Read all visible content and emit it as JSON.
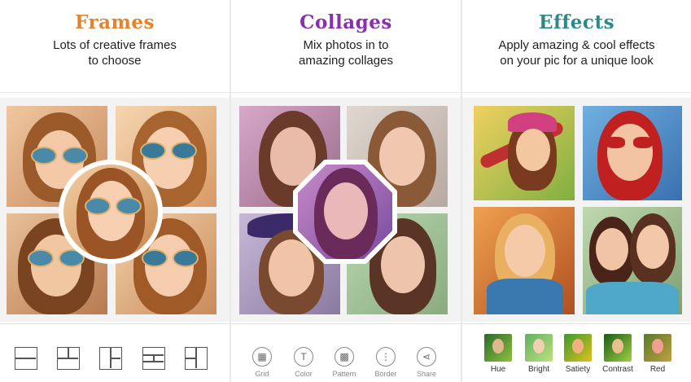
{
  "panels": [
    {
      "title": "Frames",
      "color": "#e8822a",
      "subtitle": [
        "Lots of creative frames",
        "to choose"
      ]
    },
    {
      "title": "Collages",
      "color": "#8a2fb0",
      "subtitle": [
        "Mix photos in to",
        "amazing collages"
      ]
    },
    {
      "title": "Effects",
      "color": "#2a8a8a",
      "subtitle": [
        "Apply amazing & cool effects",
        "on your pic for a unique look"
      ]
    }
  ],
  "frames_toolbar": {
    "icons": [
      "layout-two-rows-icon",
      "layout-grid-a-icon",
      "layout-grid-b-icon",
      "layout-three-rows-icon",
      "layout-grid-c-icon"
    ]
  },
  "collage_toolbar": [
    {
      "label": "Grid",
      "icon": "grid-icon",
      "glyph": "▦"
    },
    {
      "label": "Color",
      "icon": "color-icon",
      "glyph": "T"
    },
    {
      "label": "Pattern",
      "icon": "pattern-icon",
      "glyph": "▩"
    },
    {
      "label": "Border",
      "icon": "border-icon",
      "glyph": "⋮"
    },
    {
      "label": "Share",
      "icon": "share-icon",
      "glyph": "⋖"
    }
  ],
  "effects_toolbar": [
    {
      "label": "Hue"
    },
    {
      "label": "Bright"
    },
    {
      "label": "Satiety"
    },
    {
      "label": "Contrast"
    },
    {
      "label": "Red"
    }
  ]
}
